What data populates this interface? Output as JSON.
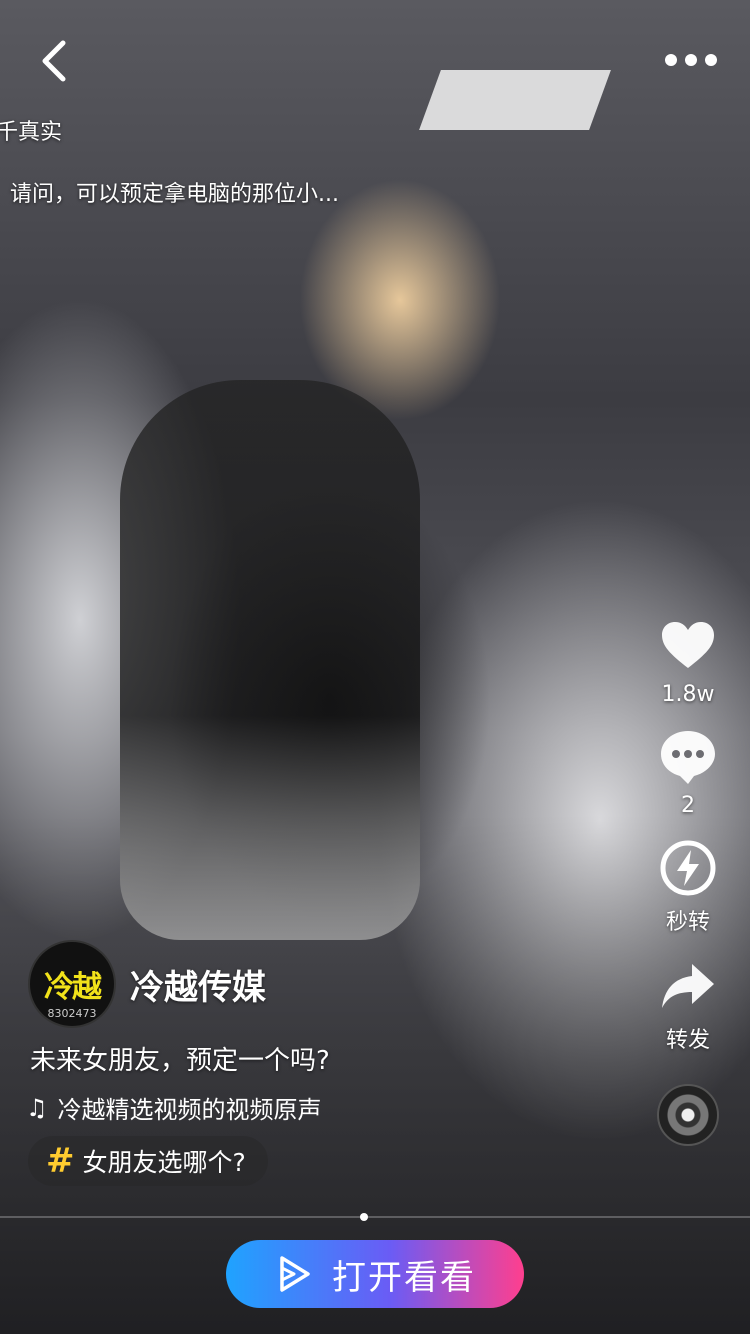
{
  "icons": {
    "back": "chevron-left-icon",
    "more": "more-horizontal-icon",
    "like": "heart-icon",
    "comment": "comment-bubble-icon",
    "quick_share": "lightning-icon",
    "forward": "share-arrow-icon",
    "music": "music-note-icon",
    "hashtag": "hashtag-icon",
    "open": "play-icon"
  },
  "overlay_comments": [
    {
      "text": "千真实"
    },
    {
      "text": "请问，可以预定拿电脑的那位小..."
    }
  ],
  "actions": {
    "like": {
      "count": "1.8w"
    },
    "comment": {
      "count": "2"
    },
    "quick_share": {
      "label": "秒转"
    },
    "forward": {
      "label": "转发"
    }
  },
  "author": {
    "avatar_text": "冷越",
    "avatar_subtext": "8302473",
    "name": "冷越传媒"
  },
  "caption": "未来女朋友，预定一个吗?",
  "music": {
    "title": "冷越精选视频的视频原声"
  },
  "hashtag": {
    "symbol": "#",
    "text": "女朋友选哪个?"
  },
  "open_button": {
    "label": "打开看看"
  },
  "colors": {
    "hashtag": "#ffcc2f",
    "button_gradient_start": "#1fa3ff",
    "button_gradient_end": "#ff3f8e"
  }
}
